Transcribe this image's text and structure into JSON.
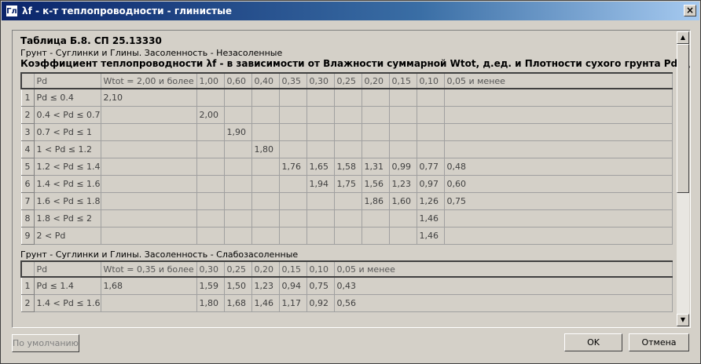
{
  "window": {
    "icon": "Гл",
    "title": "λf - к-т теплопроводности - глинистые",
    "close": "×"
  },
  "header": {
    "title": "Таблица Б.8. СП 25.13330",
    "subtitle": "Грунт - Суглинки и Глины. Засоленность - Незасоленные",
    "coef": "Коэффициент теплопроводности λf - в зависимости от Влажности суммарной Wtot, д.ед. и Плотности сухого грунта Pd, г/см3."
  },
  "table1": {
    "headers": [
      "Pd",
      "Wtot = 2,00 и более",
      "1,00",
      "0,60",
      "0,40",
      "0,35",
      "0,30",
      "0,25",
      "0,20",
      "0,15",
      "0,10",
      "0,05 и менее"
    ],
    "rows": [
      {
        "n": "1",
        "cells": [
          "Pd ≤ 0.4",
          "2,10",
          "",
          "",
          "",
          "",
          "",
          "",
          "",
          "",
          "",
          ""
        ]
      },
      {
        "n": "2",
        "cells": [
          "0.4 < Pd ≤ 0.7",
          "",
          "2,00",
          "",
          "",
          "",
          "",
          "",
          "",
          "",
          "",
          ""
        ]
      },
      {
        "n": "3",
        "cells": [
          "0.7 < Pd ≤ 1",
          "",
          "",
          "1,90",
          "",
          "",
          "",
          "",
          "",
          "",
          "",
          ""
        ]
      },
      {
        "n": "4",
        "cells": [
          "1 < Pd ≤ 1.2",
          "",
          "",
          "",
          "1,80",
          "",
          "",
          "",
          "",
          "",
          "",
          ""
        ]
      },
      {
        "n": "5",
        "cells": [
          "1.2 < Pd ≤ 1.4",
          "",
          "",
          "",
          "",
          "1,76",
          "1,65",
          "1,58",
          "1,31",
          "0,99",
          "0,77",
          "0,48"
        ]
      },
      {
        "n": "6",
        "cells": [
          "1.4 < Pd ≤ 1.6",
          "",
          "",
          "",
          "",
          "",
          "1,94",
          "1,75",
          "1,56",
          "1,23",
          "0,97",
          "0,60"
        ]
      },
      {
        "n": "7",
        "cells": [
          "1.6 < Pd ≤ 1.8",
          "",
          "",
          "",
          "",
          "",
          "",
          "",
          "1,86",
          "1,60",
          "1,26",
          "0,75"
        ]
      },
      {
        "n": "8",
        "cells": [
          "1.8 < Pd ≤ 2",
          "",
          "",
          "",
          "",
          "",
          "",
          "",
          "",
          "",
          "1,46",
          ""
        ]
      },
      {
        "n": "9",
        "cells": [
          "2 < Pd",
          "",
          "",
          "",
          "",
          "",
          "",
          "",
          "",
          "",
          "1,46",
          ""
        ]
      }
    ]
  },
  "section2": {
    "subtitle": "Грунт - Суглинки и Глины. Засоленность - Слабозасоленные"
  },
  "table2": {
    "headers": [
      "Pd",
      "Wtot = 0,35 и более",
      "0,30",
      "0,25",
      "0,20",
      "0,15",
      "0,10",
      "0,05 и менее"
    ],
    "rows": [
      {
        "n": "1",
        "cells": [
          "Pd ≤ 1.4",
          "1,68",
          "1,59",
          "1,50",
          "1,23",
          "0,94",
          "0,75",
          "0,43"
        ]
      },
      {
        "n": "2",
        "cells": [
          "1.4 < Pd ≤ 1.6",
          "",
          "1,80",
          "1,68",
          "1,46",
          "1,17",
          "0,92",
          "0,56"
        ]
      }
    ]
  },
  "buttons": {
    "default": "По умолчанию",
    "ok": "OK",
    "cancel": "Отмена"
  },
  "icons": {
    "scroll_up": "scroll-up-arrow-icon",
    "scroll_down": "scroll-down-arrow-icon"
  }
}
